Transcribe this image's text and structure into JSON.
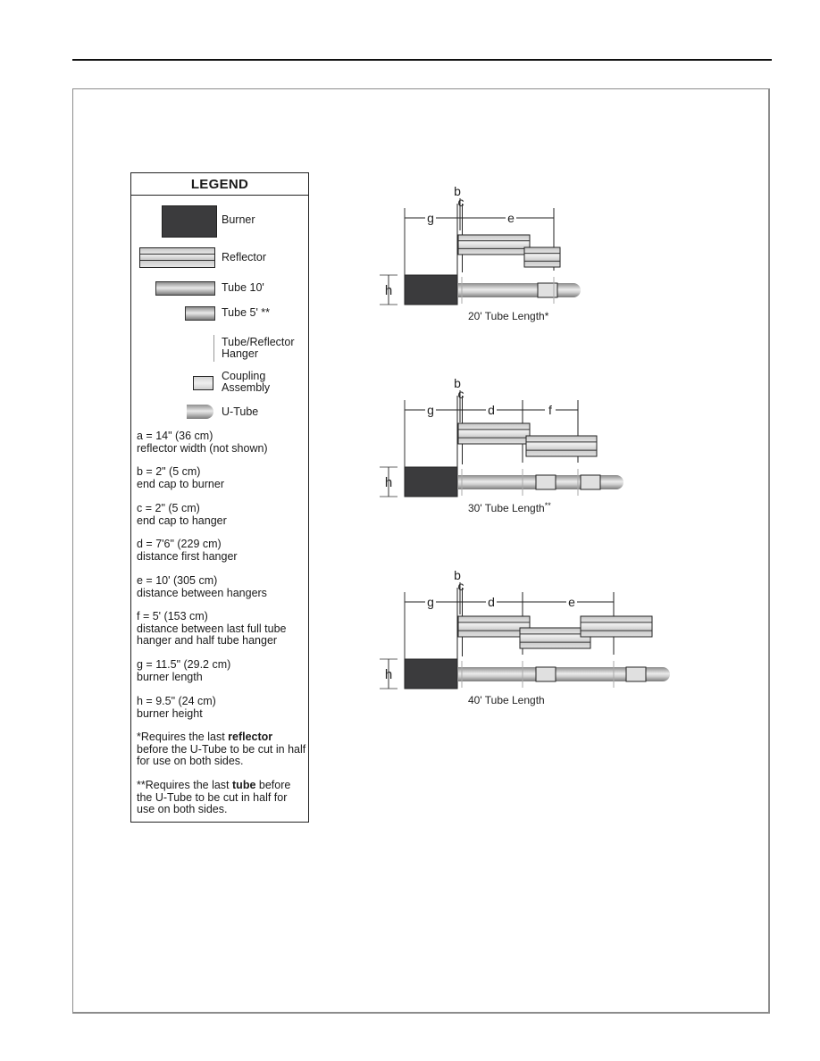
{
  "legend": {
    "title": "LEGEND",
    "symbols": [
      {
        "icon": "burner-icon",
        "label": "Burner"
      },
      {
        "icon": "reflector-icon",
        "label": "Reflector"
      },
      {
        "icon": "tube-10-icon",
        "label": "Tube 10'"
      },
      {
        "icon": "tube-5-icon",
        "label": "Tube 5' **"
      },
      {
        "icon": "hanger-icon",
        "label_line1": "Tube/Reflector",
        "label_line2": "Hanger"
      },
      {
        "icon": "coupling-icon",
        "label_line1": "Coupling",
        "label_line2": "Assembly"
      },
      {
        "icon": "u-tube-icon",
        "label": "U-Tube"
      }
    ],
    "definitions": [
      {
        "key": "a",
        "value": "a =  14\" (36 cm)",
        "desc": "reflector width (not shown)"
      },
      {
        "key": "b",
        "value": "b =  2\" (5 cm)",
        "desc": "end cap to burner"
      },
      {
        "key": "c",
        "value": "c =  2\" (5 cm)",
        "desc": "end cap to hanger"
      },
      {
        "key": "d",
        "value": "d =  7'6\" (229 cm)",
        "desc": "distance first hanger"
      },
      {
        "key": "e",
        "value": "e =  10' (305 cm)",
        "desc": "distance between hangers"
      },
      {
        "key": "f",
        "value": "f  = 5' (153 cm)",
        "desc": "distance between last full tube",
        "desc2": "hanger and half tube hanger"
      },
      {
        "key": "g",
        "value": "g = 11.5\" (29.2 cm)",
        "desc": "burner length"
      },
      {
        "key": "h",
        "value": "h =  9.5\" (24 cm)",
        "desc": "burner height"
      }
    ],
    "notes": [
      {
        "pre": "*Requires the last ",
        "bold": "reflector",
        "post": " before the U-Tube to be cut in half for use on both sides."
      },
      {
        "pre": "**Requires the last ",
        "bold": "tube",
        "post": " before the U-Tube to be cut in half for use on both sides."
      }
    ]
  },
  "diagrams": [
    {
      "caption": "20' Tube Length",
      "caption_mark": "*",
      "dims": [
        "g",
        "b",
        "c",
        "e"
      ],
      "h_label": "h"
    },
    {
      "caption": "30' Tube Length",
      "caption_mark": "**",
      "dims": [
        "g",
        "b",
        "c",
        "d",
        "f"
      ],
      "h_label": "h"
    },
    {
      "caption": "40' Tube Length",
      "caption_mark": "",
      "dims": [
        "g",
        "b",
        "c",
        "d",
        "e"
      ],
      "h_label": "h"
    }
  ]
}
